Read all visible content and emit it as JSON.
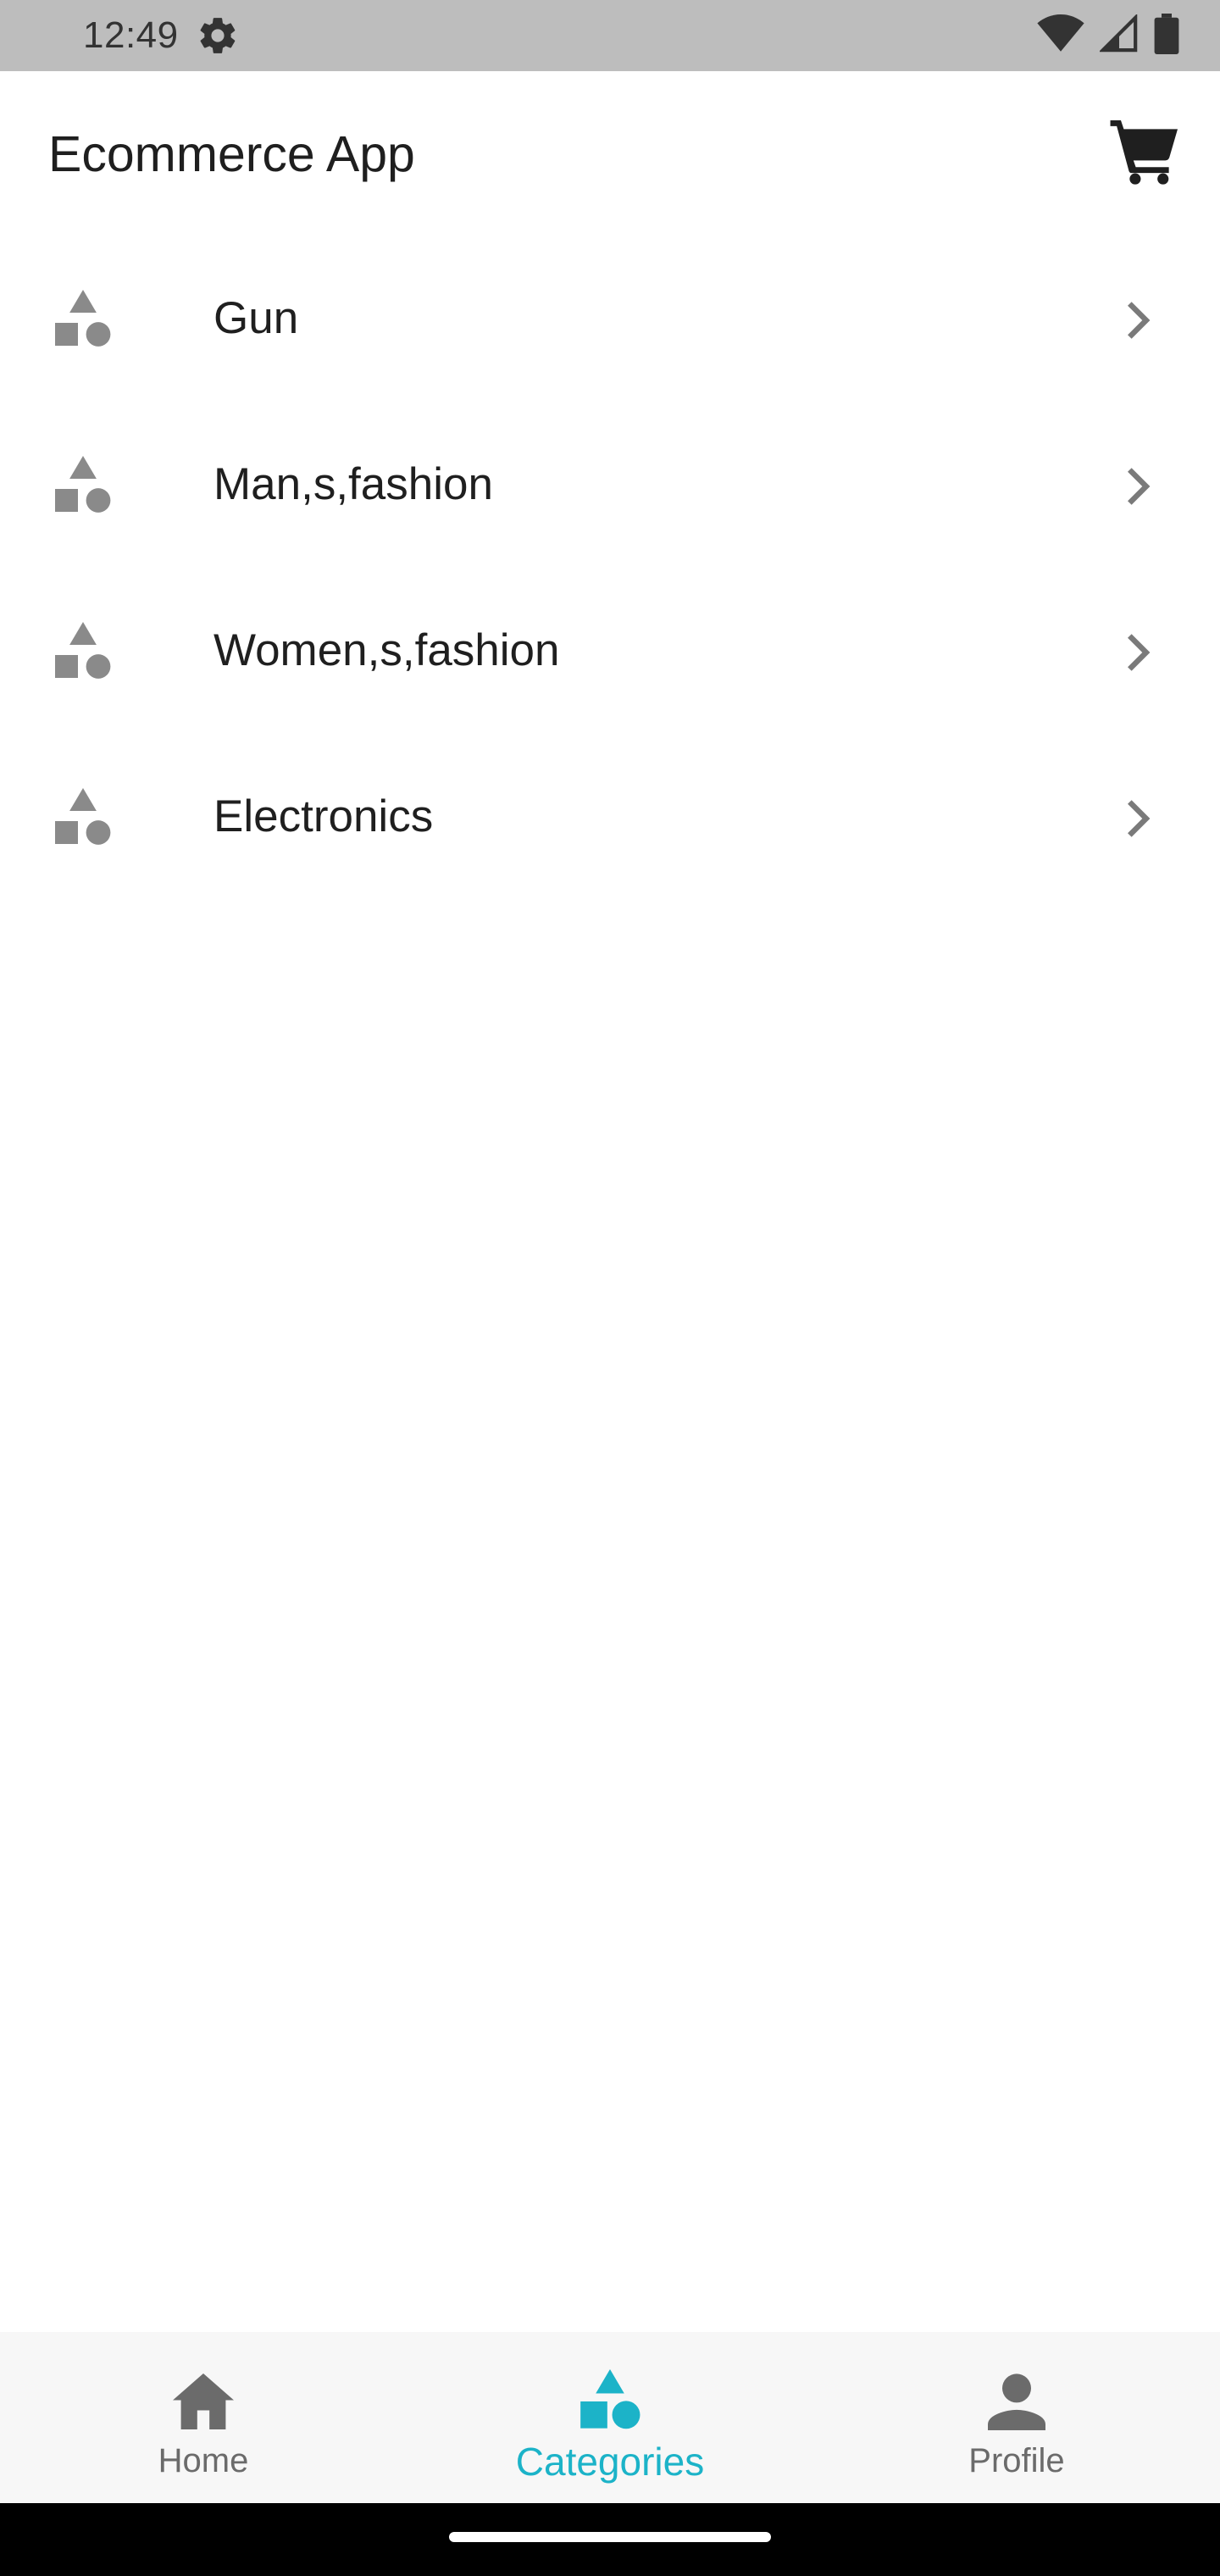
{
  "status_bar": {
    "time": "12:49",
    "icons": [
      "settings-icon",
      "wifi-icon",
      "signal-icon",
      "battery-icon"
    ]
  },
  "app_bar": {
    "title": "Ecommerce App",
    "cart_icon": "cart-icon"
  },
  "categories": [
    {
      "label": "Gun",
      "icon": "category-icon"
    },
    {
      "label": "Man,s,fashion",
      "icon": "category-icon"
    },
    {
      "label": "Women,s,fashion",
      "icon": "category-icon"
    },
    {
      "label": "Electronics",
      "icon": "category-icon"
    }
  ],
  "bottom_nav": {
    "items": [
      {
        "label": "Home",
        "icon": "home-icon",
        "active": false
      },
      {
        "label": "Categories",
        "icon": "categories-icon",
        "active": true
      },
      {
        "label": "Profile",
        "icon": "person-icon",
        "active": false
      }
    ]
  },
  "colors": {
    "accent": "#1cb3c8",
    "icon_gray": "#8a8a8a",
    "status_bar": "#bdbdbd",
    "nav_background": "#f7f7f7"
  }
}
